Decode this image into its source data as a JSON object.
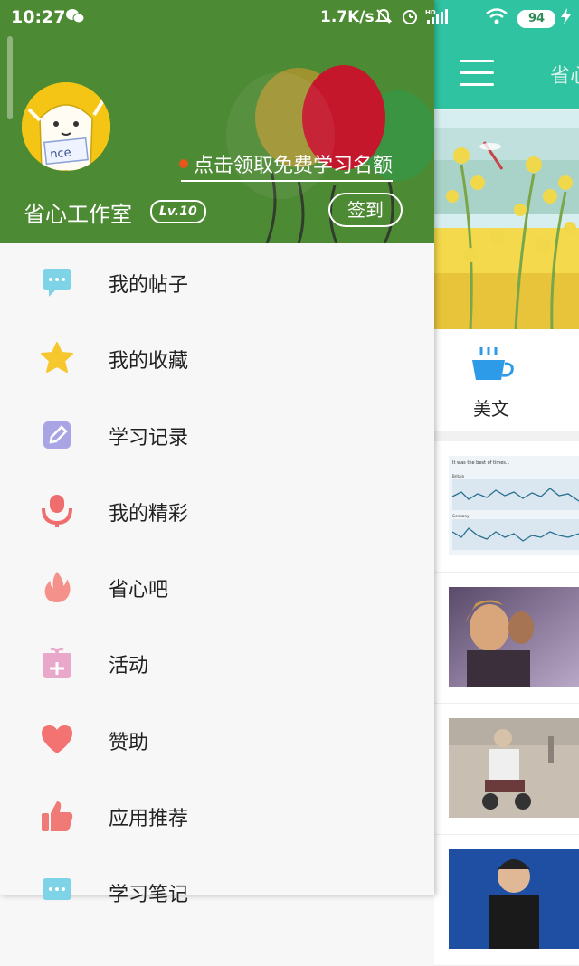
{
  "status_bar": {
    "time": "10:27",
    "wechat_icon": "wechat-icon",
    "net_speed": "1.7K/s",
    "battery": "94"
  },
  "drawer": {
    "header": {
      "promo_text": "点击领取免费学习名额",
      "avatar_text": "nce",
      "username": "省心工作室",
      "level": "Lv.10",
      "signin_label": "签到",
      "colors": {
        "header_bg": "#4d8a34",
        "promo_dot": "#e8561c"
      }
    },
    "menu": [
      {
        "label": "我的帖子",
        "icon": "chat-bubble-icon",
        "color": "#7fd3e6"
      },
      {
        "label": "我的收藏",
        "icon": "star-icon",
        "color": "#f7c72e"
      },
      {
        "label": "学习记录",
        "icon": "edit-icon",
        "color": "#a9a4e3"
      },
      {
        "label": "我的精彩",
        "icon": "microphone-icon",
        "color": "#ef6d6d"
      },
      {
        "label": "省心吧",
        "icon": "flame-icon",
        "color": "#f4918b"
      },
      {
        "label": "活动",
        "icon": "gift-icon",
        "color": "#e9a8c9"
      },
      {
        "label": "赞助",
        "icon": "heart-icon",
        "color": "#f37272"
      },
      {
        "label": "应用推荐",
        "icon": "thumbs-up-icon",
        "color": "#f07a76"
      },
      {
        "label": "学习笔记",
        "icon": "note-icon",
        "color": "#7fd3e6"
      }
    ]
  },
  "main": {
    "topbar_title": "省心",
    "topbar_color": "#2fc3a1",
    "category": {
      "label": "美文",
      "icon": "cup-icon",
      "color": "#2e9be8"
    },
    "thumb_chart": {
      "title": "It was the best of times...",
      "panel_labels": [
        "Britain",
        "Germany"
      ]
    }
  }
}
